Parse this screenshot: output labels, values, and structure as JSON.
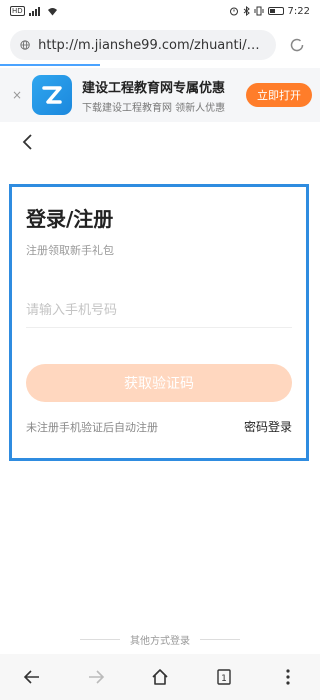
{
  "status_bar": {
    "left_badge": "HD",
    "time": "7:22"
  },
  "browser": {
    "url": "http://m.jianshe99.com/zhuanti/2020do..."
  },
  "banner": {
    "close_glyph": "×",
    "title": "建设工程教育网专属优惠",
    "subtitle": "下载建设工程教育网 领新人优惠",
    "open_label": "立即打开"
  },
  "login": {
    "title": "登录/注册",
    "subtitle": "注册领取新手礼包",
    "phone_placeholder": "请输入手机号码",
    "get_code_label": "获取验证码",
    "auto_register_note": "未注册手机验证后自动注册",
    "password_login_label": "密码登录"
  },
  "other_methods": {
    "label": "其他方式登录"
  },
  "toolbar": {
    "tabs_count": "1"
  },
  "colors": {
    "accent_orange": "#ff7d2a",
    "disabled_button": "#ffd7bf",
    "highlight_border": "#2f8ce0"
  }
}
